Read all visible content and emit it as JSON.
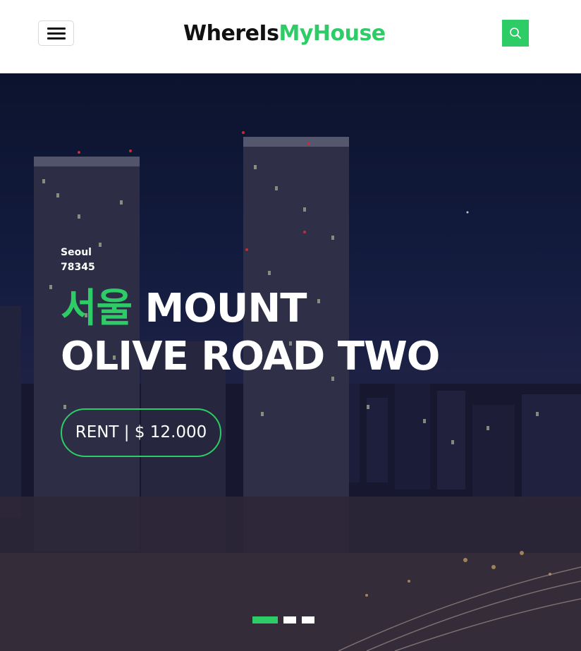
{
  "header": {
    "logo_part1": "WhereIs",
    "logo_part2": "MyHouse",
    "menu_icon": "hamburger-icon",
    "search_icon": "search-icon"
  },
  "hero": {
    "city": "Seoul",
    "zip": "78345",
    "title_accent": "서울",
    "title_line1": "MOUNT",
    "title_line2": "OLIVE ROAD TWO",
    "price_label": "RENT | $ 12.000",
    "slides_total": 3,
    "slide_active": 1
  },
  "colors": {
    "accent": "#2ecc66",
    "dark": "#111111",
    "white": "#ffffff"
  }
}
